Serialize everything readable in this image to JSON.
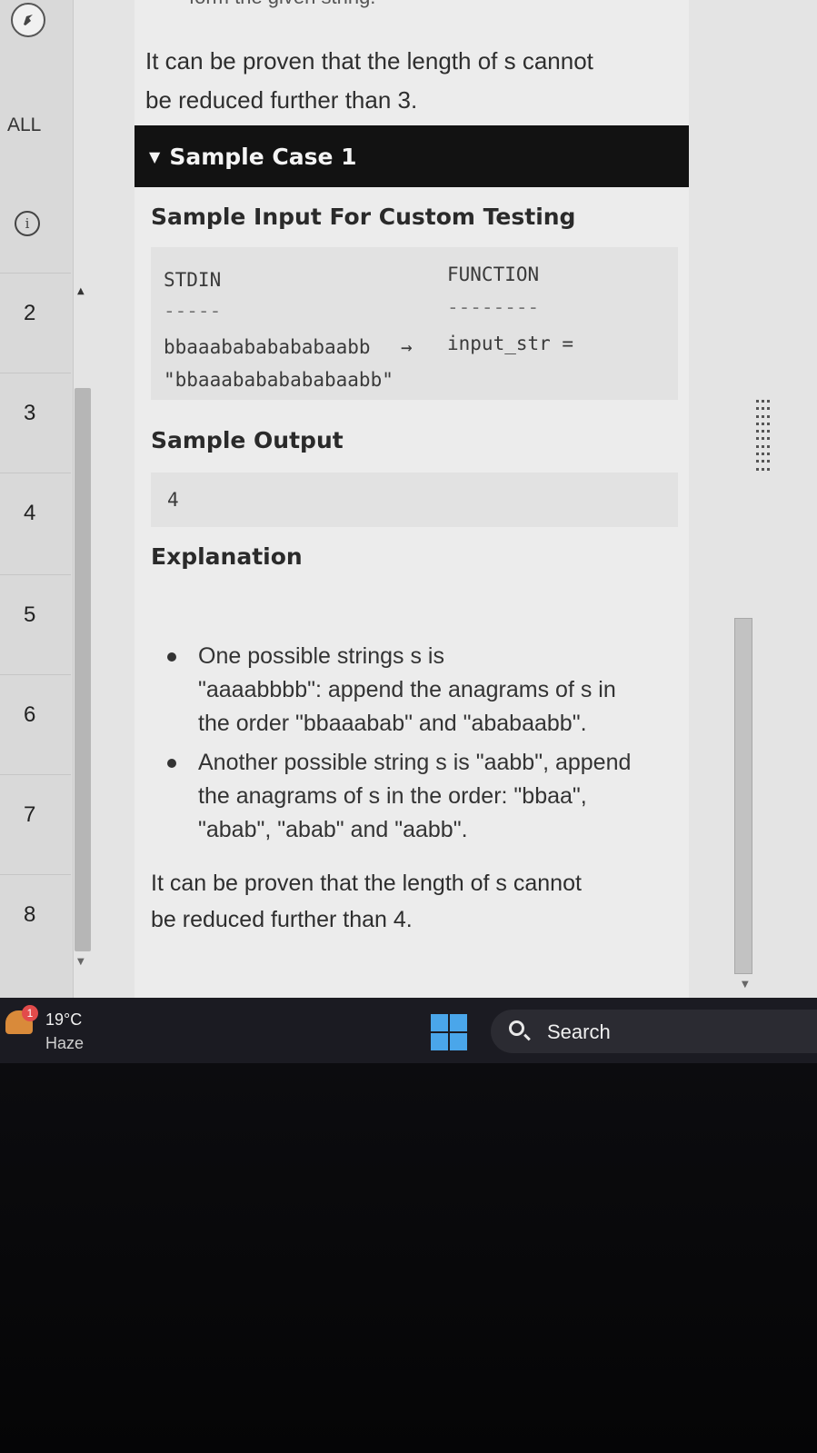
{
  "sidebar": {
    "all_label": "ALL",
    "question_numbers": [
      "2",
      "3",
      "4",
      "5",
      "6",
      "7",
      "8"
    ]
  },
  "content": {
    "cut_off_text": "form the given string.",
    "intro_paragraph_line1": "It can be proven that the length of s cannot",
    "intro_paragraph_line2": "be reduced further than 3.",
    "sample_case_title": "Sample Case 1",
    "sample_input_heading": "Sample Input For Custom Testing",
    "stdin_header": "STDIN",
    "function_header": "FUNCTION",
    "stdin_divider": "-----",
    "function_divider": "--------",
    "stdin_value": "bbaaabababababaabb",
    "arrow": "→",
    "function_value": "input_str =",
    "function_value_line2": "\"bbaaabababababaabb\"",
    "sample_output_heading": "Sample Output",
    "sample_output_value": "4",
    "explanation_heading": "Explanation",
    "bullets": [
      {
        "line1": "One possible strings s is",
        "line2": "\"aaaabbbb\": append the anagrams of s in",
        "line3": "the order \"bbaaabab\" and \"ababaabb\"."
      },
      {
        "line1": "Another possible string s is \"aabb\", append",
        "line2": "the anagrams of s in the order: \"bbaa\",",
        "line3": "\"abab\", \"abab\" and \"aabb\"."
      }
    ],
    "closing_paragraph_line1": "It can be proven that the length of s cannot",
    "closing_paragraph_line2": "be reduced further than 4."
  },
  "taskbar": {
    "notification_count": "1",
    "temperature": "19°C",
    "condition": "Haze",
    "search_label": "Search"
  },
  "icons": {
    "logo": "hackerrank-logo-icon",
    "info": "info-icon",
    "weather": "weather-icon",
    "windows": "windows-start-icon",
    "search": "search-icon"
  },
  "colors": {
    "header_bg": "#121212",
    "page_bg": "#ececec",
    "taskbar_bg": "#1b1b22",
    "windows_accent": "#4aa6ea"
  }
}
